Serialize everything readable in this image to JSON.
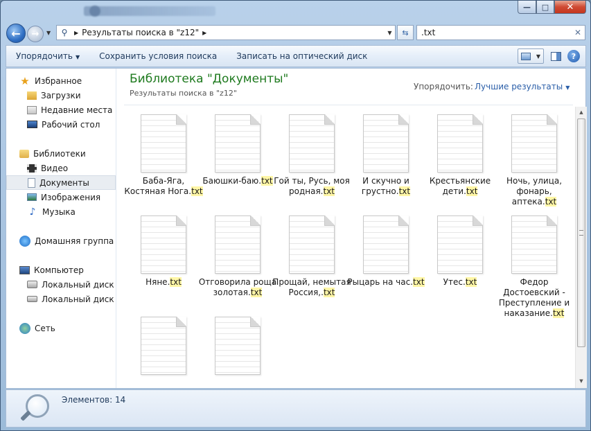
{
  "address": {
    "crumb": "Результаты поиска в \"z12\""
  },
  "search": {
    "value": ".txt"
  },
  "toolbar": {
    "organize": "Упорядочить",
    "save_search": "Сохранить условия поиска",
    "burn": "Записать на оптический диск"
  },
  "sidebar": {
    "favorites": "Избранное",
    "downloads": "Загрузки",
    "recent": "Недавние места",
    "desktop": "Рабочий стол",
    "libraries": "Библиотеки",
    "video": "Видео",
    "documents": "Документы",
    "images": "Изображения",
    "music": "Музыка",
    "homegroup": "Домашняя группа",
    "computer": "Компьютер",
    "disk_c": "Локальный диск (C",
    "disk_d": "Локальный диск (D",
    "network": "Сеть"
  },
  "header": {
    "title": "Библиотека \"Документы\"",
    "subtitle": "Результаты поиска в \"z12\"",
    "sort_label": "Упорядочить:",
    "sort_value": "Лучшие результаты"
  },
  "files": [
    {
      "name": "Баба-Яга, Костяная Нога",
      "ext": "txt"
    },
    {
      "name": "Баюшки-баю",
      "ext": "txt"
    },
    {
      "name": "Гой ты, Русь, моя родная",
      "ext": "txt"
    },
    {
      "name": "И скучно и грустно",
      "ext": "txt"
    },
    {
      "name": "Крестьянские дети",
      "ext": "txt"
    },
    {
      "name": "Ночь, улица, фонарь, аптека",
      "ext": "txt"
    },
    {
      "name": "Няне",
      "ext": "txt"
    },
    {
      "name": "Отговорила роща золотая",
      "ext": "txt"
    },
    {
      "name": "Прощай, немытая Россия,",
      "ext": "txt"
    },
    {
      "name": "Рыцарь на час",
      "ext": "txt"
    },
    {
      "name": "Утес",
      "ext": "txt"
    },
    {
      "name": "Федор Достоевский - Преступление и наказание",
      "ext": "txt"
    },
    {
      "name": "",
      "ext": ""
    },
    {
      "name": "",
      "ext": ""
    }
  ],
  "status": {
    "count": "Элементов: 14"
  }
}
